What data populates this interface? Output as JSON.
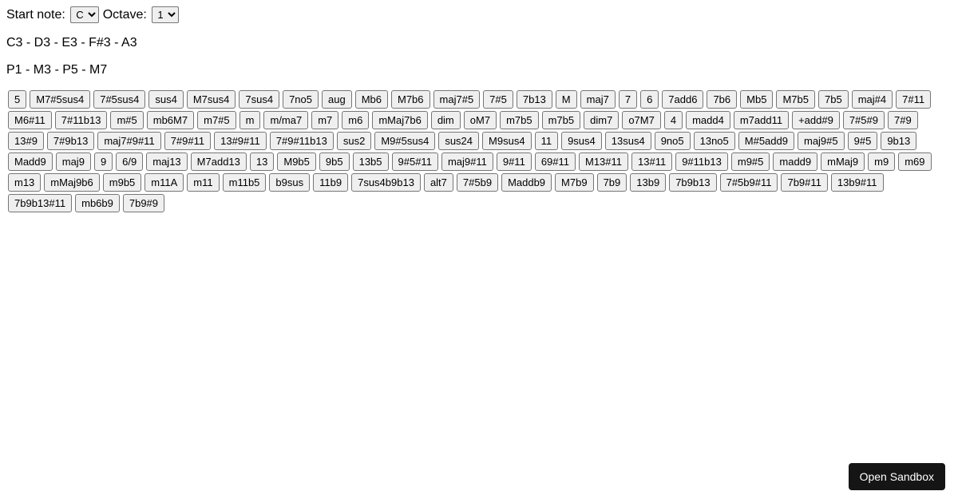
{
  "controls": {
    "startNoteLabel": "Start note:",
    "octaveLabel": "Octave:",
    "startNoteSelected": "C",
    "octaveSelected": "1"
  },
  "notesText": "C3 - D3 - E3 - F#3 - A3",
  "intervalsText": "P1 - M3 - P5 - M7",
  "chords": [
    "5",
    "M7#5sus4",
    "7#5sus4",
    "sus4",
    "M7sus4",
    "7sus4",
    "7no5",
    "aug",
    "Mb6",
    "M7b6",
    "maj7#5",
    "7#5",
    "7b13",
    "M",
    "maj7",
    "7",
    "6",
    "7add6",
    "7b6",
    "Mb5",
    "M7b5",
    "7b5",
    "maj#4",
    "7#11",
    "M6#11",
    "7#11b13",
    "m#5",
    "mb6M7",
    "m7#5",
    "m",
    "m/ma7",
    "m7",
    "m6",
    "mMaj7b6",
    "dim",
    "oM7",
    "m7b5",
    "m7b5",
    "dim7",
    "o7M7",
    "4",
    "madd4",
    "m7add11",
    "+add#9",
    "7#5#9",
    "7#9",
    "13#9",
    "7#9b13",
    "maj7#9#11",
    "7#9#11",
    "13#9#11",
    "7#9#11b13",
    "sus2",
    "M9#5sus4",
    "sus24",
    "M9sus4",
    "11",
    "9sus4",
    "13sus4",
    "9no5",
    "13no5",
    "M#5add9",
    "maj9#5",
    "9#5",
    "9b13",
    "Madd9",
    "maj9",
    "9",
    "6/9",
    "maj13",
    "M7add13",
    "13",
    "M9b5",
    "9b5",
    "13b5",
    "9#5#11",
    "maj9#11",
    "9#11",
    "69#11",
    "M13#11",
    "13#11",
    "9#11b13",
    "m9#5",
    "madd9",
    "mMaj9",
    "m9",
    "m69",
    "m13",
    "mMaj9b6",
    "m9b5",
    "m11A",
    "m11",
    "m11b5",
    "b9sus",
    "11b9",
    "7sus4b9b13",
    "alt7",
    "7#5b9",
    "Maddb9",
    "M7b9",
    "7b9",
    "13b9",
    "7b9b13",
    "7#5b9#11",
    "7b9#11",
    "13b9#11",
    "7b9b13#11",
    "mb6b9",
    "7b9#9"
  ],
  "sandboxLabel": "Open Sandbox"
}
